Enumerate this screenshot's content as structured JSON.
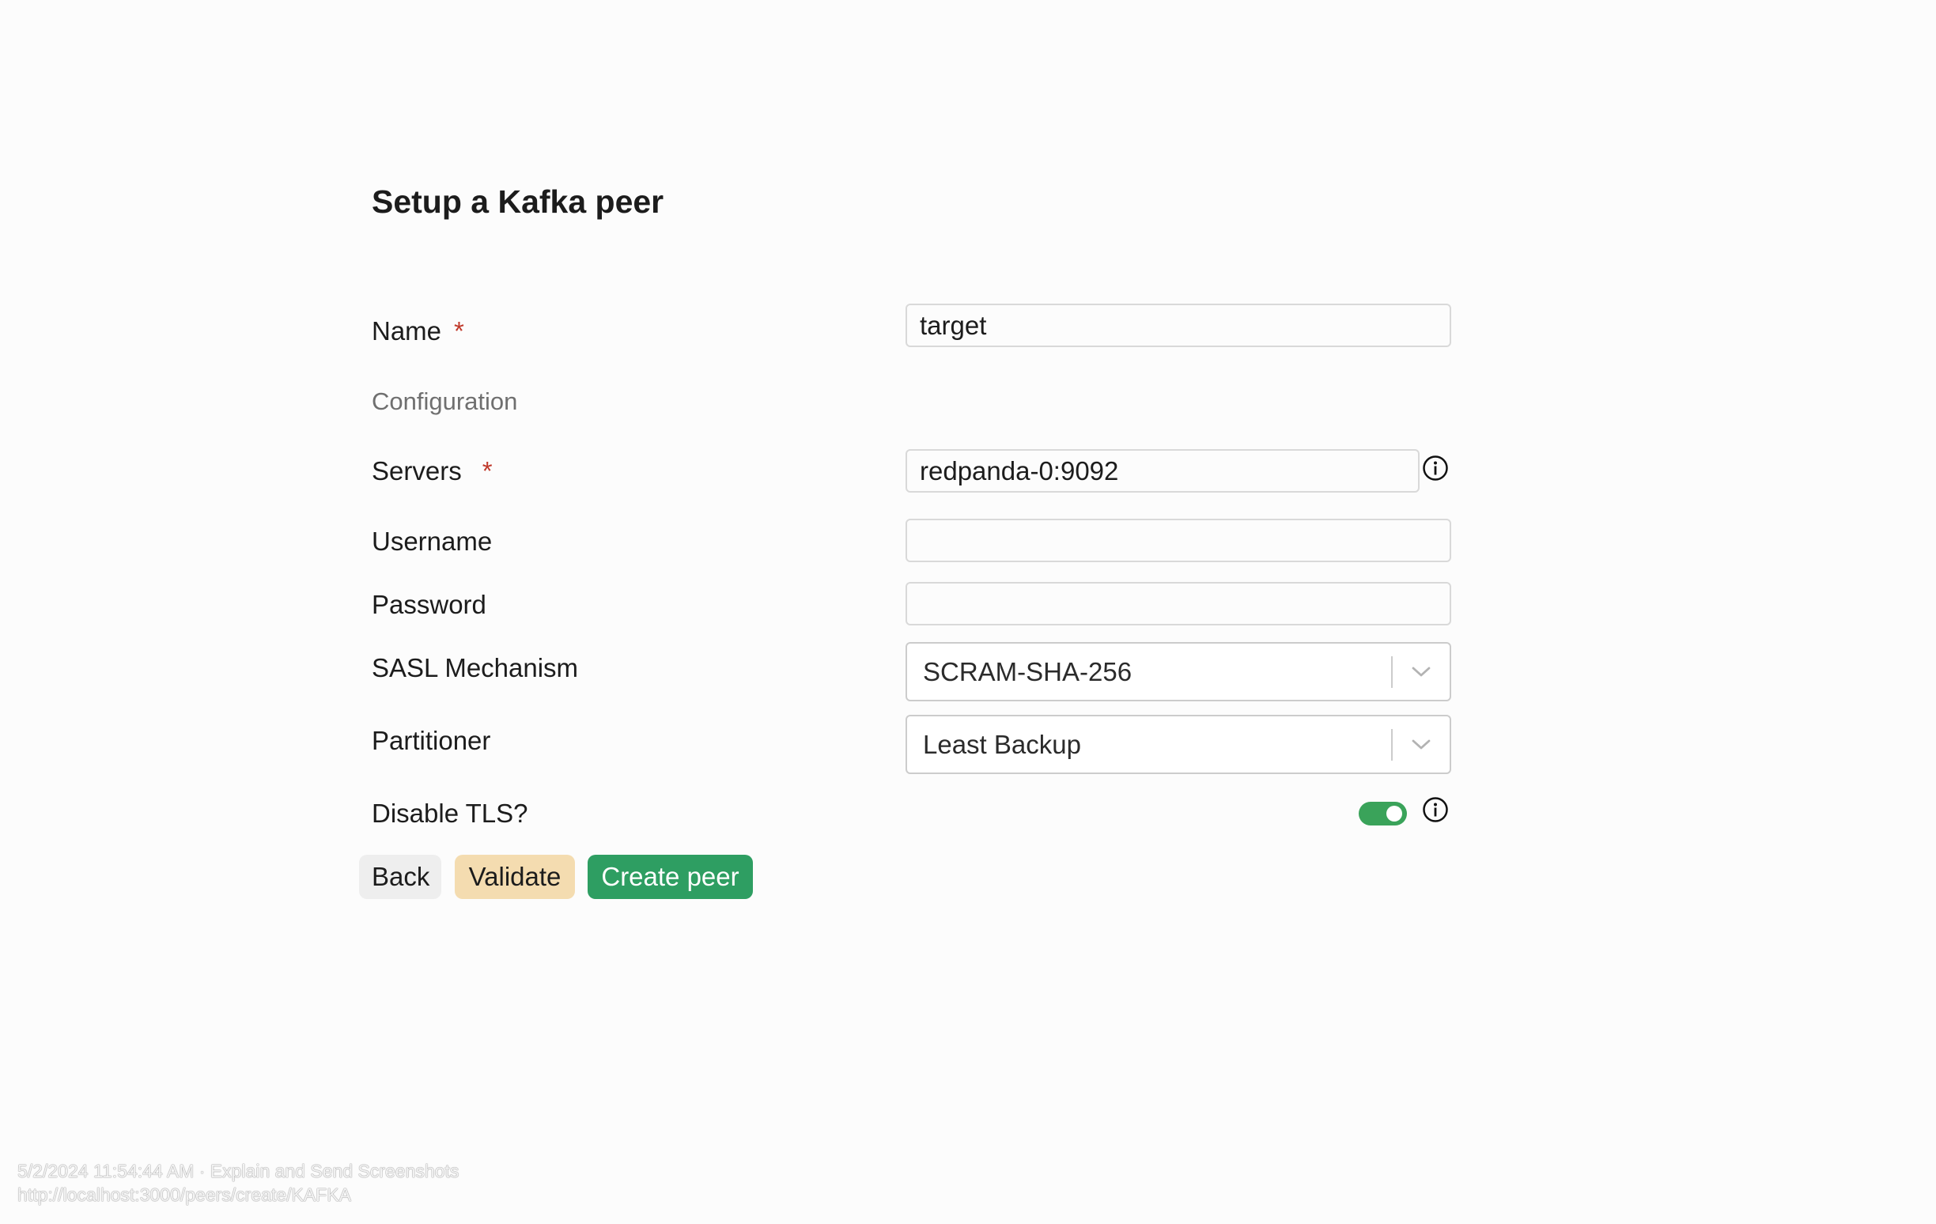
{
  "form": {
    "title": "Setup a Kafka peer",
    "name": {
      "label": "Name",
      "required_mark": "*",
      "value": "target"
    },
    "configuration_label": "Configuration",
    "servers": {
      "label": "Servers",
      "required_mark": "*",
      "value": "redpanda-0:9092"
    },
    "username": {
      "label": "Username",
      "value": ""
    },
    "password": {
      "label": "Password",
      "value": ""
    },
    "sasl_mechanism": {
      "label": "SASL Mechanism",
      "selected": "SCRAM-SHA-256"
    },
    "partitioner": {
      "label": "Partitioner",
      "selected": "Least Backup"
    },
    "disable_tls": {
      "label": "Disable TLS?",
      "checked": true
    }
  },
  "actions": {
    "back_label": "Back",
    "validate_label": "Validate",
    "create_label": "Create peer"
  },
  "footer": {
    "line1": "5/2/2024 11:54:44 AM · Explain and Send Screenshots",
    "line2": "http://localhost:3000/peers/create/KAFKA"
  },
  "colors": {
    "primary_green": "#2e9e62",
    "validate_bg": "#f4dcb0",
    "toggle_on": "#3aa35a",
    "required_mark": "#c0392b"
  },
  "icons": {
    "servers_info": "info-circle-icon",
    "tls_info": "info-circle-icon",
    "select_indicator": "chevron-down-icon"
  }
}
